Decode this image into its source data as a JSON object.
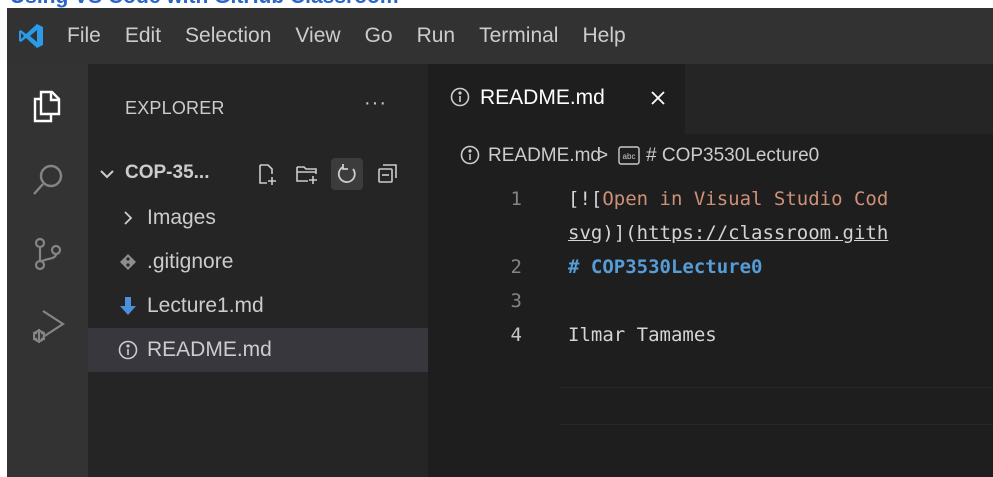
{
  "top_strip": {
    "text": "Using VS Code with GitHub Classroom"
  },
  "menu": [
    "File",
    "Edit",
    "Selection",
    "View",
    "Go",
    "Run",
    "Terminal",
    "Help"
  ],
  "activity_icons": [
    "explorer-icon",
    "search-icon",
    "source-control-icon",
    "run-debug-icon"
  ],
  "sidebar": {
    "title": "EXPLORER",
    "more": "···",
    "folder_name": "COP-35...",
    "folder_actions": [
      "new-file-icon",
      "new-folder-icon",
      "refresh-icon",
      "collapse-all-icon"
    ],
    "items": [
      {
        "label": "Images",
        "icon": "chevron-right-icon",
        "selected": false
      },
      {
        "label": ".gitignore",
        "icon": "git-diamond-icon",
        "selected": false
      },
      {
        "label": "Lecture1.md",
        "icon": "markdown-arrow-icon",
        "selected": false
      },
      {
        "label": "README.md",
        "icon": "info-icon",
        "selected": true
      }
    ]
  },
  "editor": {
    "tab_label": "README.md",
    "breadcrumb": {
      "file": "README.md",
      "separator": ">",
      "heading": "# COP3530Lecture0"
    },
    "lines": [
      {
        "number": "1",
        "part1": "[![",
        "part2": "Open in Visual Studio Cod"
      },
      {
        "number": "",
        "part1": "svg",
        "part2": ")](",
        "part3": "https://classroom.gith"
      },
      {
        "number": "2",
        "text": "# COP3530Lecture0"
      },
      {
        "number": "3",
        "text": ""
      },
      {
        "number": "4",
        "text": "Ilmar Tamames"
      }
    ]
  },
  "colors": {
    "menubar": "#323233",
    "activitybar": "#333333",
    "sidebar": "#252526",
    "editor": "#1e1e1e",
    "selection": "#37373d",
    "accent_blue": "#007acc",
    "string": "#ce9178",
    "keyword": "#569cd6"
  }
}
